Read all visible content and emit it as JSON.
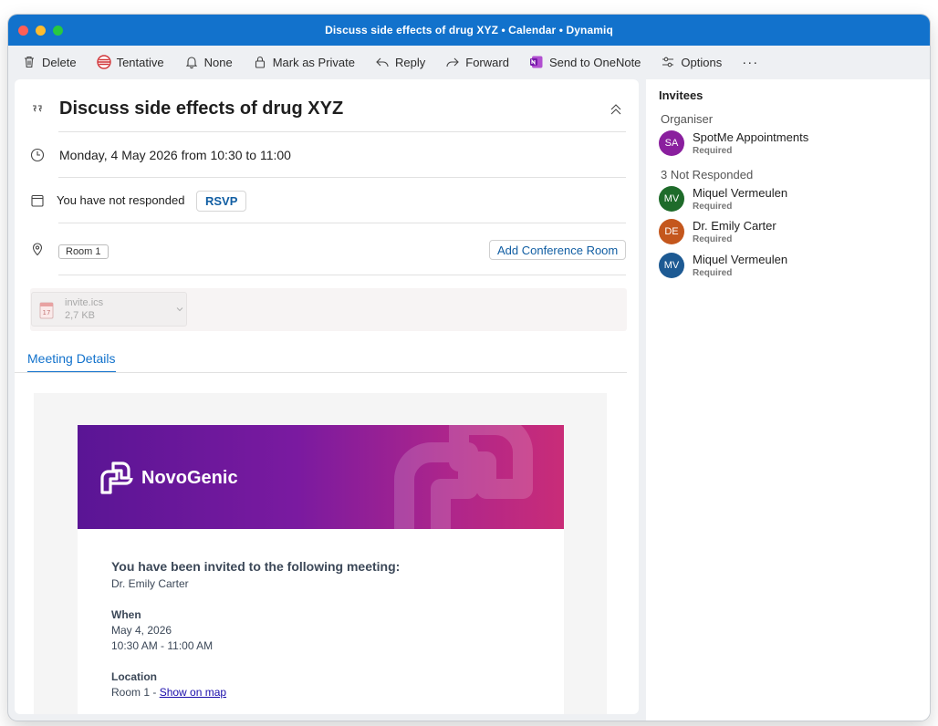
{
  "window": {
    "title": "Discuss side effects of drug XYZ • Calendar • Dynamiq"
  },
  "toolbar": {
    "delete": "Delete",
    "tentative": "Tentative",
    "none": "None",
    "mark_private": "Mark as Private",
    "reply": "Reply",
    "forward": "Forward",
    "send_onenote": "Send to OneNote",
    "options": "Options",
    "more": "···"
  },
  "event": {
    "subject": "Discuss side effects of drug XYZ",
    "datetime": "Monday, 4 May 2026 from 10:30 to 11:00",
    "response_status": "You have not responded",
    "rsvp_label": "RSVP",
    "location_chip": "Room 1",
    "add_room_label": "Add Conference Room"
  },
  "attachment": {
    "name": "invite.ics",
    "size": "2,7 KB"
  },
  "tabs": {
    "meeting_details": "Meeting Details"
  },
  "email": {
    "brand": "NovoGenic",
    "heading": "You have been invited to the following meeting:",
    "host": "Dr. Emily Carter",
    "when_label": "When",
    "date": "May 4, 2026",
    "time": "10:30 AM - 11:00 AM",
    "location_label": "Location",
    "location_text": "Room 1 - ",
    "map_link": "Show on map"
  },
  "invitees": {
    "title": "Invitees",
    "organiser_label": "Organiser",
    "not_responded_label": "3 Not Responded",
    "people": [
      {
        "initials": "SA",
        "name": "SpotMe Appointments",
        "role": "Required",
        "color": "#8a1f9e"
      },
      {
        "initials": "MV",
        "name": "Miquel Vermeulen",
        "role": "Required",
        "color": "#1e6b2a"
      },
      {
        "initials": "DE",
        "name": "Dr. Emily Carter",
        "role": "Required",
        "color": "#c4571d"
      },
      {
        "initials": "MV",
        "name": "Miquel Vermeulen",
        "role": "Required",
        "color": "#1d5a93"
      }
    ]
  },
  "colors": {
    "accent": "#1272cc",
    "link": "#115ea3"
  }
}
